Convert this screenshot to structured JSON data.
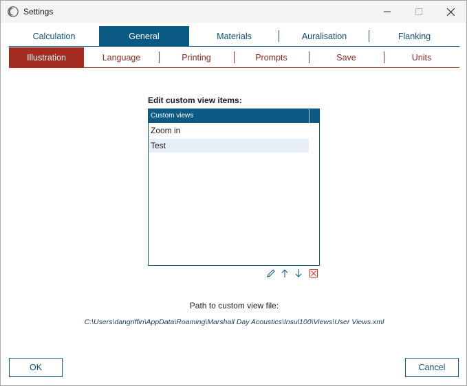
{
  "window": {
    "title": "Settings"
  },
  "primary_tabs": [
    {
      "label": "Calculation",
      "active": false
    },
    {
      "label": "General",
      "active": true
    },
    {
      "label": "Materials",
      "active": false
    },
    {
      "label": "Auralisation",
      "active": false
    },
    {
      "label": "Flanking",
      "active": false
    }
  ],
  "secondary_tabs": [
    {
      "label": "Illustration",
      "active": true
    },
    {
      "label": "Language",
      "active": false
    },
    {
      "label": "Printing",
      "active": false
    },
    {
      "label": "Prompts",
      "active": false
    },
    {
      "label": "Save",
      "active": false
    },
    {
      "label": "Units",
      "active": false
    }
  ],
  "custom_views": {
    "heading": "Edit custom view items:",
    "column_header": "Custom views",
    "items": [
      "Zoom in",
      "Test"
    ],
    "selected_index": 1,
    "actions": [
      "edit-icon",
      "move-up-icon",
      "move-down-icon",
      "delete-icon"
    ]
  },
  "path": {
    "label": "Path to custom view file:",
    "value": "C:\\Users\\dangriffin\\AppData\\Roaming\\Marshall Day Acoustics\\Insul100\\Views\\User Views.xml"
  },
  "buttons": {
    "ok": "OK",
    "cancel": "Cancel"
  },
  "colors": {
    "primary_accent": "#0b5a83",
    "secondary_accent": "#a32b20",
    "selection": "#e5eef4"
  }
}
